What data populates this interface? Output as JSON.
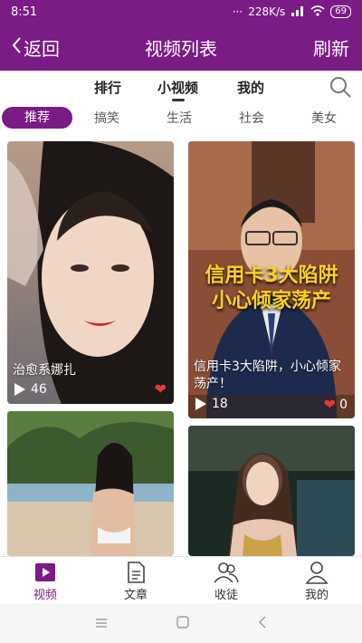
{
  "status": {
    "time": "8:51",
    "dots": "···",
    "network": "228K/s",
    "battery": "69"
  },
  "header": {
    "back_label": "返回",
    "title": "视频列表",
    "refresh_label": "刷新"
  },
  "top_tabs": [
    "排行",
    "小视频",
    "我的"
  ],
  "categories": [
    "推荐",
    "搞笑",
    "生活",
    "社会",
    "美女"
  ],
  "videos": [
    {
      "caption": "治愈系娜扎",
      "plays": "46",
      "likes": ""
    },
    {
      "caption": "信用卡3大陷阱，小心倾家荡产！",
      "plays": "18",
      "likes": "0",
      "overlay_text": [
        "信用卡3大陷阱",
        "小心倾家荡产"
      ]
    },
    {
      "caption": "",
      "plays": "",
      "likes": ""
    },
    {
      "caption": "",
      "plays": "",
      "likes": ""
    }
  ],
  "bottom_nav": [
    "视频",
    "文章",
    "收徒",
    "我的"
  ],
  "colors": {
    "brand": "#7a1b86",
    "heart": "#e53935"
  },
  "icons": [
    "back-chevron-icon",
    "search-icon",
    "play-icon",
    "heart-icon",
    "video-icon",
    "article-icon",
    "users-icon",
    "user-icon",
    "menu-icon",
    "home-icon",
    "back-icon"
  ]
}
